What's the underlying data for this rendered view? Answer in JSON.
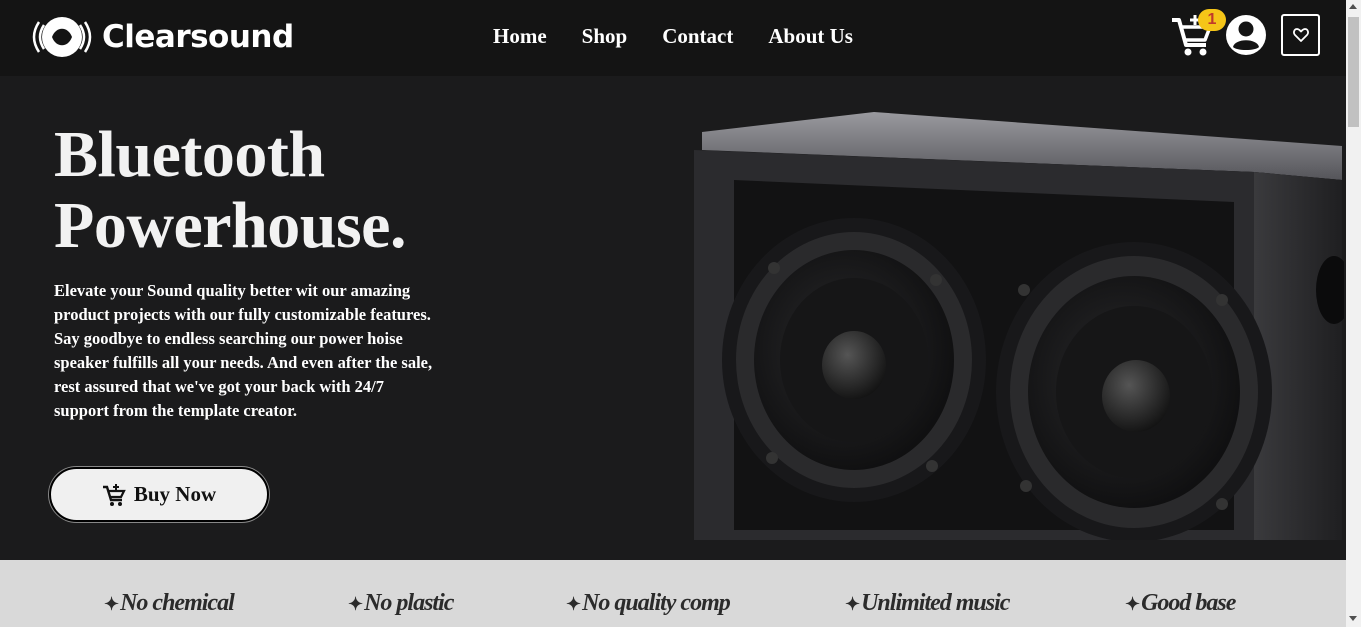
{
  "brand": {
    "name": "Clearsound",
    "logo_icon": "speaker-waves-logo"
  },
  "nav": {
    "items": [
      {
        "label": "Home"
      },
      {
        "label": "Shop"
      },
      {
        "label": "Contact"
      },
      {
        "label": "About Us"
      }
    ]
  },
  "header_actions": {
    "cart_icon": "cart-plus-icon",
    "cart_count": "1",
    "user_icon": "user-circle-icon",
    "wishlist_icon": "heart-icon",
    "badge_color": "#f5c518"
  },
  "hero": {
    "title_line1": "Bluetooth",
    "title_line2": "Powerhouse.",
    "description": "Elevate your Sound quality better wit our amazing product projects with our fully customizable features. Say goodbye to endless searching our power hoise speaker fulfills all your needs. And even after the sale, rest assured that we've got your back with 24/7 support from the template creator.",
    "cta_label": "Buy Now",
    "cta_icon": "cart-plus-icon"
  },
  "features": [
    {
      "label": "No chemical"
    },
    {
      "label": "No plastic"
    },
    {
      "label": "No quality comp"
    },
    {
      "label": "Unlimited music"
    },
    {
      "label": "Good base"
    }
  ],
  "colors": {
    "background": "#1b1b1c",
    "navbar": "#141414",
    "features_bar": "#d9d9d9"
  }
}
